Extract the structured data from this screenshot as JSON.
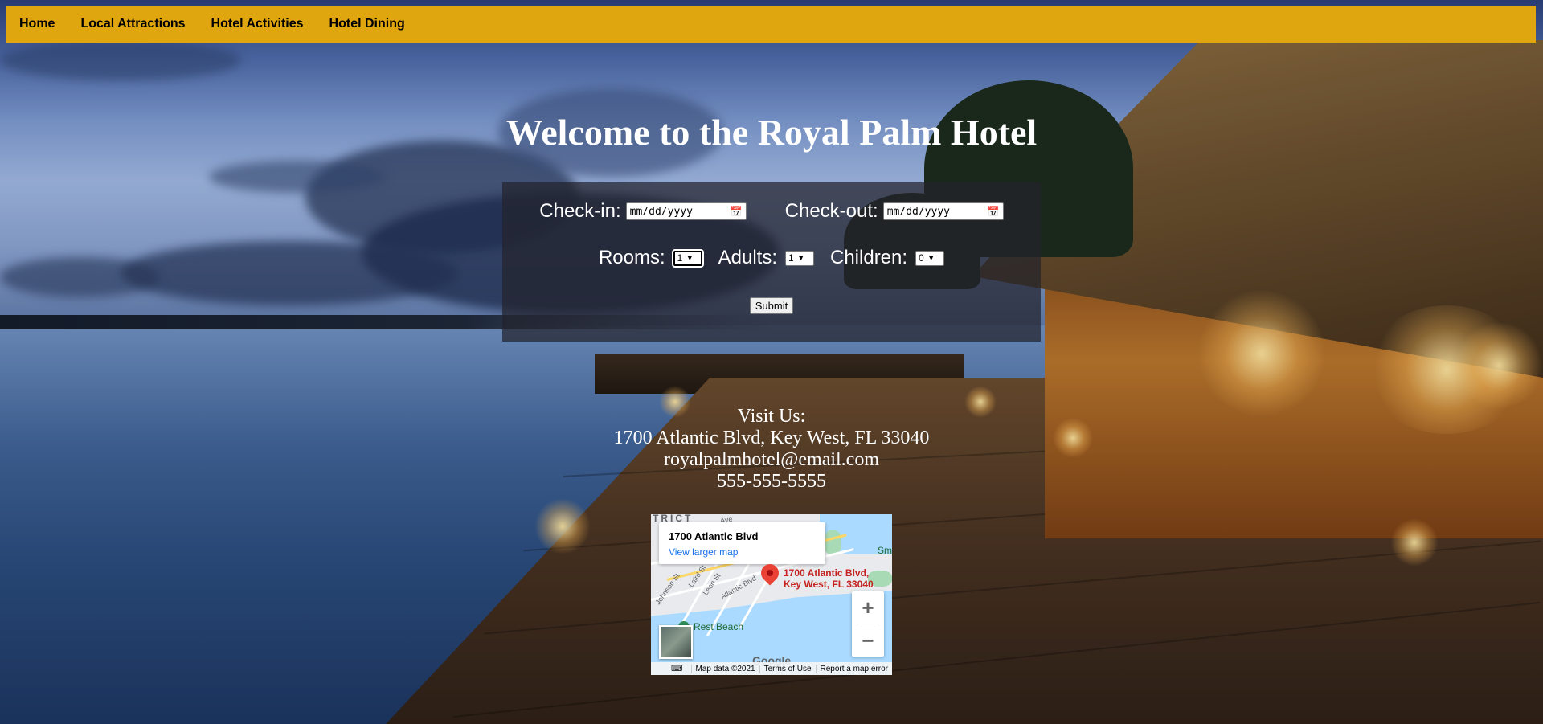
{
  "nav": {
    "items": [
      {
        "label": "Home"
      },
      {
        "label": "Local Attractions"
      },
      {
        "label": "Hotel Activities"
      },
      {
        "label": "Hotel Dining"
      }
    ]
  },
  "hero": {
    "title": "Welcome to the Royal Palm Hotel"
  },
  "booking": {
    "checkin_label": "Check-in:",
    "checkin_value": "mm/dd/yyyy",
    "checkout_label": "Check-out:",
    "checkout_value": "mm/dd/yyyy",
    "rooms_label": "Rooms:",
    "rooms_value": "1",
    "adults_label": "Adults:",
    "adults_value": "1",
    "children_label": "Children:",
    "children_value": "0",
    "submit_label": "Submit"
  },
  "contact": {
    "heading": "Visit Us:",
    "address": "1700 Atlantic Blvd, Key West, FL 33040",
    "email": "royalpalmhotel@email.com",
    "phone": "555-555-5555"
  },
  "map": {
    "card_title": "1700 Atlantic Blvd",
    "card_link": "View larger map",
    "pin_line1": "1700 Atlantic Blvd,",
    "pin_line2": "Key West, FL 33040",
    "district": "TRICT",
    "beach": "Rest Beach",
    "google": "Google",
    "map_data": "Map data ©2021",
    "terms": "Terms of Use",
    "report": "Report a map error",
    "zoom_in": "+",
    "zoom_out": "−",
    "smallcut": "Sm",
    "streets": [
      "Johnson St",
      "Laird St",
      "Leon St",
      "Atlantic Blvd",
      "Ave"
    ]
  },
  "colors": {
    "nav_bg": "#e0a610",
    "accent_link": "#1a73e8",
    "pin": "#ea4335"
  }
}
